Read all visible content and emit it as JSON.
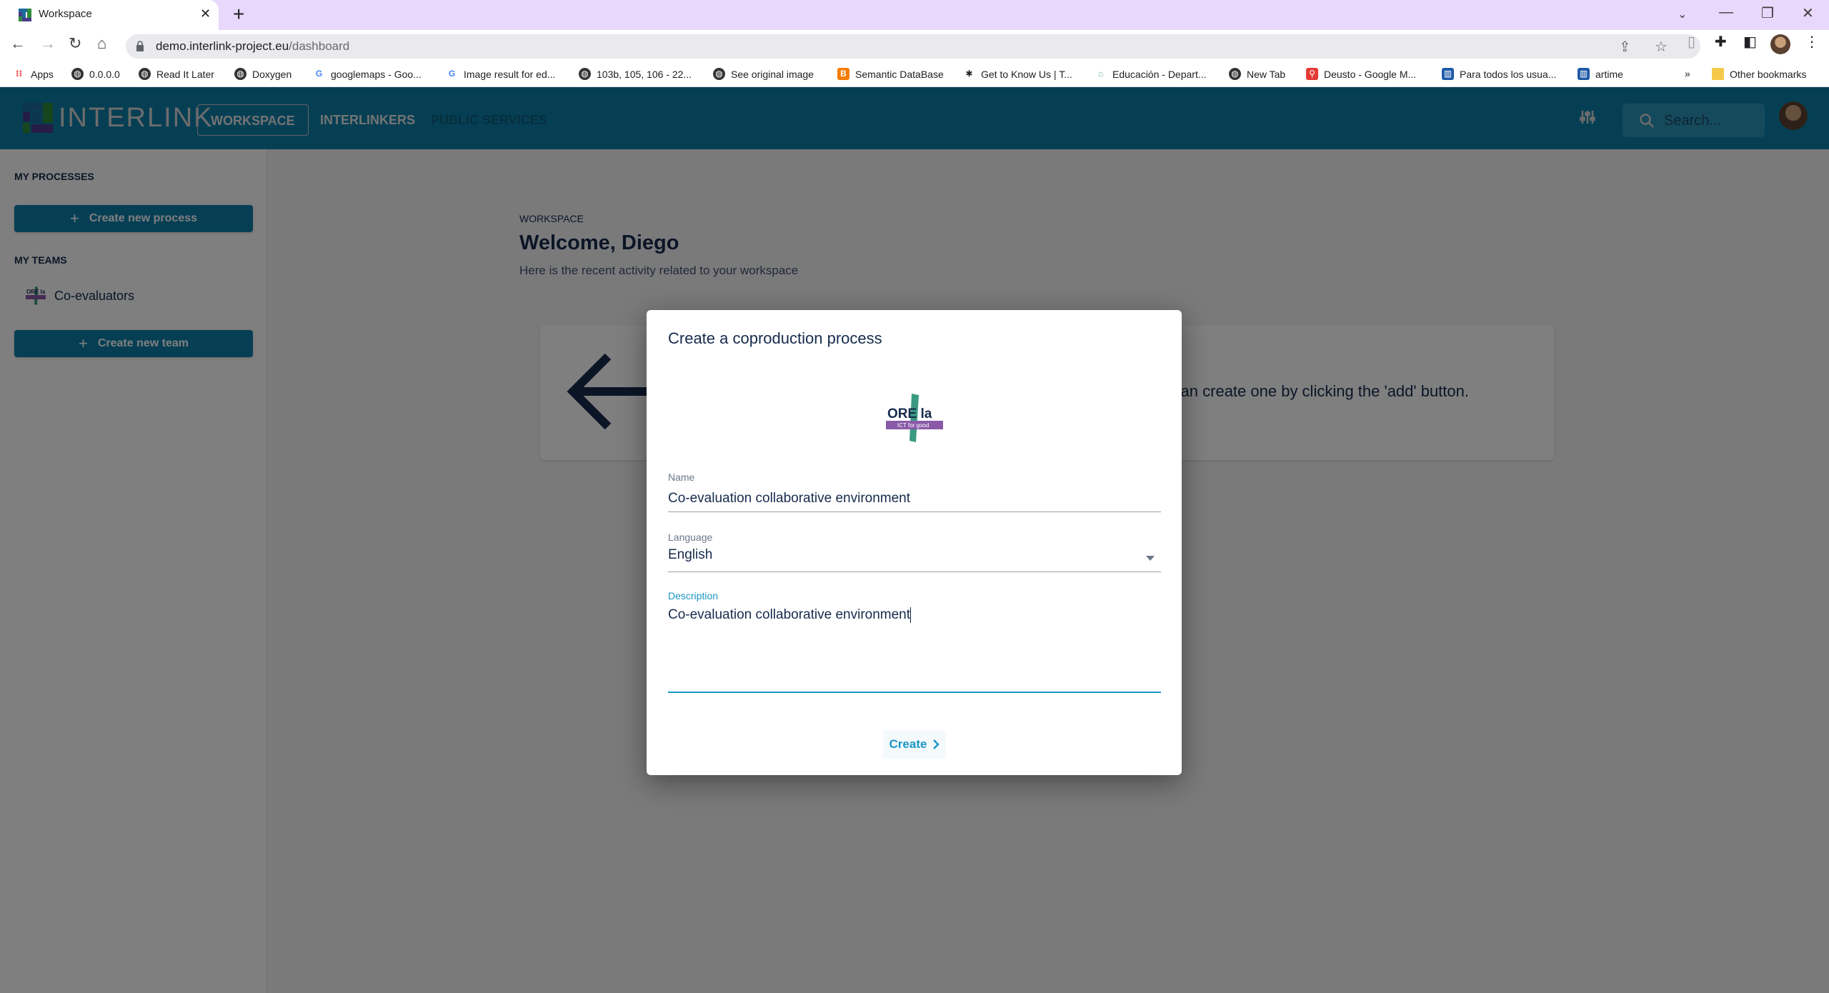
{
  "browser": {
    "tab_title": "Workspace",
    "url_host": "demo.interlink-project.eu",
    "url_path": "/dashboard",
    "bookmarks": [
      {
        "label": "Apps",
        "icon": "apps-grid-icon"
      },
      {
        "label": "0.0.0.0",
        "icon": "globe-icon"
      },
      {
        "label": "Read It Later",
        "icon": "globe-icon"
      },
      {
        "label": "Doxygen",
        "icon": "globe-icon"
      },
      {
        "label": "googlemaps - Goo...",
        "icon": "google-icon"
      },
      {
        "label": "Image result for ed...",
        "icon": "google-icon"
      },
      {
        "label": "103b, 105, 106 - 22...",
        "icon": "globe-icon"
      },
      {
        "label": "See original image",
        "icon": "globe-icon"
      },
      {
        "label": "Semantic DataBase",
        "icon": "blogger-icon"
      },
      {
        "label": "Get to Know Us | T...",
        "icon": "site-icon"
      },
      {
        "label": "Educación - Depart...",
        "icon": "site-icon"
      },
      {
        "label": "New Tab",
        "icon": "globe-icon"
      },
      {
        "label": "Deusto - Google M...",
        "icon": "maps-pin-icon"
      },
      {
        "label": "Para todos los usua...",
        "icon": "deusto-icon"
      },
      {
        "label": "artime",
        "icon": "deusto-icon"
      }
    ],
    "overflow_label": "»",
    "other_bookmarks": "Other bookmarks"
  },
  "app": {
    "logo_text": "INTERLINK",
    "nav": {
      "workspace": "WORKSPACE",
      "interlinkers": "INTERLINKERS",
      "public_services": "PUBLIC SERVICES"
    },
    "search_placeholder": "Search...",
    "colors": {
      "primary": "#0c7fa9",
      "accent": "#1a97c4",
      "text": "#172b4d"
    }
  },
  "sidebar": {
    "processes_heading": "MY PROCESSES",
    "create_process": "Create new process",
    "teams_heading": "MY TEAMS",
    "teams": [
      {
        "name": "Co-evaluators"
      }
    ],
    "create_team": "Create new team"
  },
  "main": {
    "breadcrumb": "WORKSPACE",
    "title": "Welcome, Diego",
    "subtitle": "Here is the recent activity related to your workspace",
    "empty_message": "You don't have any processes yet. You can create one by clicking the 'add' button."
  },
  "modal": {
    "title": "Create a coproduction process",
    "logo_text": "MORE lab",
    "logo_tagline": "ICT for good",
    "name_label": "Name",
    "name_value": "Co-evaluation collaborative environment",
    "language_label": "Language",
    "language_value": "English",
    "description_label": "Description",
    "description_value": "Co-evaluation collaborative environment",
    "create_label": "Create"
  }
}
